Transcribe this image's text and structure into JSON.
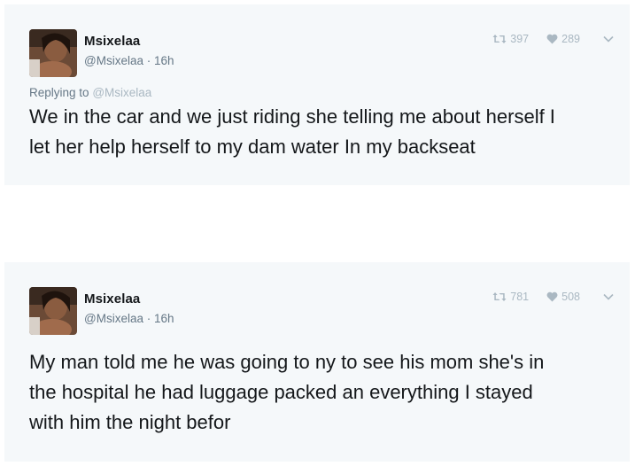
{
  "tweets": [
    {
      "display_name": "Msixelaa",
      "handle": "@Msixelaa",
      "separator": "·",
      "time": "16h",
      "retweets": "397",
      "likes": "289",
      "replying_prefix": "Replying to",
      "replying_to": "@Msixelaa",
      "text": "We in the car and we just riding she telling me about herself I\nlet her help herself to my dam water In my backseat"
    },
    {
      "display_name": "Msixelaa",
      "handle": "@Msixelaa",
      "separator": "·",
      "time": "16h",
      "retweets": "781",
      "likes": "508",
      "text": "My man told me he was going to ny to see his mom she's in\nthe hospital he had luggage packed an everything I stayed\nwith him the night befor"
    }
  ],
  "icons": {
    "retweet": "retweet-icon",
    "like": "heart-icon",
    "more": "chevron-down-icon"
  },
  "colors": {
    "card_background": "#f5f8fa",
    "text_primary": "#14171a",
    "text_secondary": "#657786",
    "action_gray": "#aab8c2"
  }
}
